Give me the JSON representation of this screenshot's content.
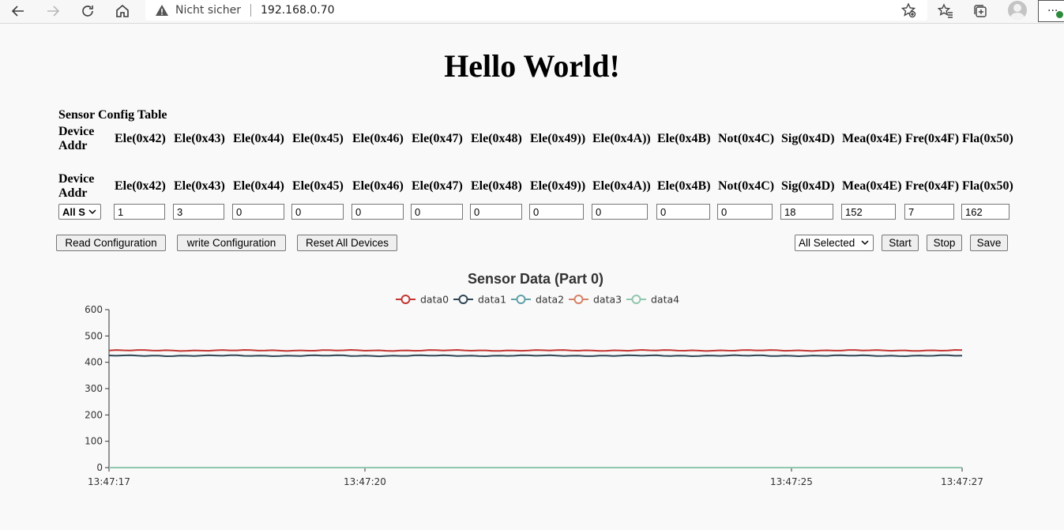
{
  "browser": {
    "security_label": "Nicht sicher",
    "address": "192.168.0.70",
    "menu_label": "..."
  },
  "page": {
    "heading": "Hello World!",
    "table_caption": "Sensor Config Table",
    "header_row_1": [
      "Device Addr",
      "Ele(0x42)",
      "Ele(0x43)",
      "Ele(0x44)",
      "Ele(0x45)",
      "Ele(0x46)",
      "Ele(0x47)",
      "Ele(0x48)",
      "Ele(0x49))",
      "Ele(0x4A))",
      "Ele(0x4B)",
      "Not(0x4C)",
      "Sig(0x4D)",
      "Mea(0x4E)",
      "Fre(0x4F)",
      "Fla(0x50)"
    ],
    "header_row_2": [
      "Device Addr",
      "Ele(0x42)",
      "Ele(0x43)",
      "Ele(0x44)",
      "Ele(0x45)",
      "Ele(0x46)",
      "Ele(0x47)",
      "Ele(0x48)",
      "Ele(0x49))",
      "Ele(0x4A))",
      "Ele(0x4B)",
      "Not(0x4C)",
      "Sig(0x4D)",
      "Mea(0x4E)",
      "Fre(0x4F)",
      "Fla(0x50)"
    ],
    "device_select": "All S",
    "input_values": [
      "1",
      "3",
      "0",
      "0",
      "0",
      "0",
      "0",
      "0",
      "0",
      "0",
      "0",
      "18",
      "152",
      "7",
      "162"
    ],
    "buttons": {
      "read": "Read Configuration",
      "write": "write Configuration",
      "reset": "Reset All Devices",
      "start": "Start",
      "stop": "Stop",
      "save": "Save"
    },
    "selection_select": "All Selected"
  },
  "chart_data": {
    "type": "line",
    "title": "Sensor Data (Part 0)",
    "ylim": [
      0,
      600
    ],
    "y_ticks": [
      "0",
      "100",
      "200",
      "300",
      "400",
      "500",
      "600"
    ],
    "x_range": [
      "13:47:17",
      "13:47:27"
    ],
    "x_ticks": [
      {
        "label": "13:47:17",
        "t": 0
      },
      {
        "label": "13:47:20",
        "t": 3
      },
      {
        "label": "13:47:25",
        "t": 8
      },
      {
        "label": "13:47:27",
        "t": 10
      }
    ],
    "legend_position": "top-center",
    "series": [
      {
        "name": "data0",
        "color": "#c23531",
        "value": 445
      },
      {
        "name": "data1",
        "color": "#2f4554",
        "value": 425
      },
      {
        "name": "data2",
        "color": "#61a0a8",
        "value": 0
      },
      {
        "name": "data3",
        "color": "#d48265",
        "value": 0
      },
      {
        "name": "data4",
        "color": "#91c7ae",
        "value": 0
      }
    ]
  }
}
